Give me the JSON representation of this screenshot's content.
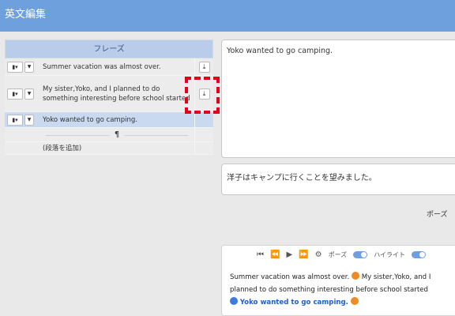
{
  "app": {
    "title": "英文編集"
  },
  "phrases": {
    "header": "フレーズ",
    "rows": [
      {
        "text": "Summer vacation was almost over."
      },
      {
        "text": "My sister,Yoko, and I planned to do something interesting before school started"
      },
      {
        "text": "Yoko wanted to go camping."
      }
    ],
    "pilcrow": "¶",
    "add_paragraph": "(段落を追加)"
  },
  "editor": {
    "english": "Yoko wanted to go camping.",
    "japanese": "洋子はキャンプに行くことを望みました。"
  },
  "pause_label": "ポーズ",
  "player": {
    "pause_toggle_label": "ポーズ",
    "highlight_toggle_label": "ハイライト",
    "sentences": [
      "Summer vacation was almost over.",
      "My sister,Yoko, and I planned to do something interesting before school started",
      "Yoko wanted to go camping."
    ]
  },
  "colors": {
    "header": "#6fa0de",
    "selection": "#c9d9ef",
    "highlight_box": "#e3001b"
  }
}
